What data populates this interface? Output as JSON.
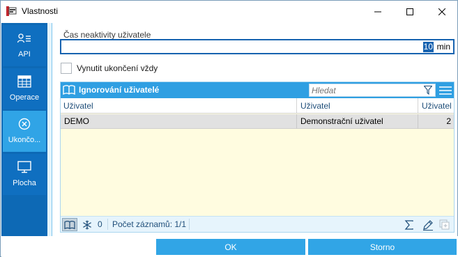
{
  "window": {
    "title": "Vlastnosti",
    "controls": {
      "minimize_icon": "minimize-icon",
      "maximize_icon": "maximize-icon",
      "close_icon": "close-icon"
    }
  },
  "nav": {
    "items": [
      {
        "label": "API",
        "icon": "user-list-icon",
        "active": false
      },
      {
        "label": "Operace",
        "icon": "table-grid-icon",
        "active": false
      },
      {
        "label": "Ukončo...",
        "icon": "circle-x-icon",
        "active": true
      },
      {
        "label": "Plocha",
        "icon": "monitor-icon",
        "active": false
      }
    ]
  },
  "inactivity": {
    "label": "Čas neaktivity uživatele",
    "value": "10",
    "unit": "min"
  },
  "force_end": {
    "label": "Vynutit ukončení vždy",
    "checked": false
  },
  "ignored_users": {
    "title": "Ignorování uživatelé",
    "search_placeholder": "Hledat",
    "columns": [
      "Uživatel",
      "Uživatel",
      "Uživatel"
    ],
    "rows": [
      {
        "code": "DEMO",
        "name": "Demonstrační uživatel",
        "number": "2"
      }
    ],
    "footer": {
      "count": "0",
      "records_label": "Počet záznamů: 1/1"
    }
  },
  "buttons": {
    "ok": "OK",
    "cancel": "Storno"
  },
  "colors": {
    "nav_bg": "#0d69b5",
    "nav_active": "#30a4e6",
    "panel_header": "#2f9fe2",
    "grid_bg": "#fffce0",
    "button": "#31a5e6"
  }
}
